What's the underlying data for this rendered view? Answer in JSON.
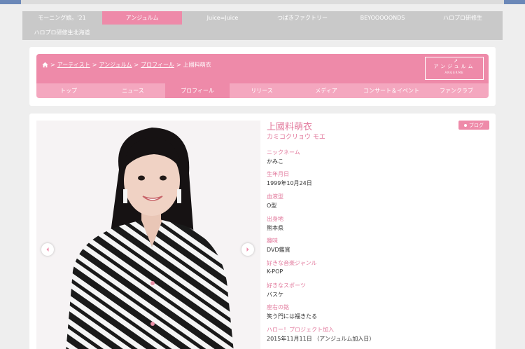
{
  "group_nav": {
    "items": [
      {
        "label": "モーニング娘。'21",
        "active": false
      },
      {
        "label": "アンジュルム",
        "active": true
      },
      {
        "label": "Juice=Juice",
        "active": false
      },
      {
        "label": "つばきファクトリー",
        "active": false
      },
      {
        "label": "BEYOOOOONDS",
        "active": false
      },
      {
        "label": "ハロプロ研修生",
        "active": false
      },
      {
        "label": "ハロプロ研修生北海道",
        "active": false
      }
    ]
  },
  "breadcrumb": {
    "items": [
      "アーティスト",
      "アンジュルム",
      "プロフィール"
    ],
    "current": "上國料萌衣",
    "separator": ">"
  },
  "logo": {
    "main": "アンジュルム",
    "sub": "ANGERME"
  },
  "sub_nav": {
    "items": [
      {
        "label": "トップ",
        "active": false
      },
      {
        "label": "ニュース",
        "active": false
      },
      {
        "label": "プロフィール",
        "active": true
      },
      {
        "label": "リリース",
        "active": false
      },
      {
        "label": "メディア",
        "active": false
      },
      {
        "label": "コンサート＆イベント",
        "active": false
      },
      {
        "label": "ファンクラブ",
        "active": false
      }
    ]
  },
  "profile": {
    "name": "上國料萌衣",
    "kana": "カミコクリョウ モエ",
    "blog_label": "ブログ",
    "fields": [
      {
        "label": "ニックネーム",
        "value": "かみこ"
      },
      {
        "label": "生年月日",
        "value": "1999年10月24日"
      },
      {
        "label": "血液型",
        "value": "O型"
      },
      {
        "label": "出身地",
        "value": "熊本県"
      },
      {
        "label": "趣味",
        "value": "DVD鑑賞"
      },
      {
        "label": "好きな音楽ジャンル",
        "value": "K-POP"
      },
      {
        "label": "好きなスポーツ",
        "value": "バスケ"
      },
      {
        "label": "座右の銘",
        "value": "笑う門には福きたる"
      },
      {
        "label": "ハロー！プロジェクト加入",
        "value": "2015年11月11日 （アンジュルム加入日）"
      }
    ]
  },
  "colors": {
    "accent": "#ee8aa9",
    "accent_light": "#f4a7bf",
    "label_pink": "#e2799c",
    "nav_gray": "#c9c9c9"
  },
  "icons": {
    "home": "home-icon",
    "prev": "chevron-left-icon",
    "next": "chevron-right-icon"
  }
}
